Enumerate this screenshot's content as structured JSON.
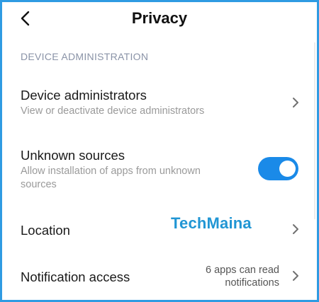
{
  "header": {
    "title": "Privacy",
    "back_icon": "chevron-left-icon"
  },
  "section": {
    "label": "DEVICE ADMINISTRATION"
  },
  "items": [
    {
      "title": "Device administrators",
      "subtitle": "View or deactivate device administrators",
      "icon": "chevron-right-icon"
    },
    {
      "title": "Unknown sources",
      "subtitle": "Allow installation of apps from unknown sources",
      "toggle_on": true,
      "toggle_color": "#1a8ae8"
    },
    {
      "title": "Location",
      "icon": "chevron-right-icon"
    },
    {
      "title": "Notification access",
      "value": "6 apps can read notifications",
      "icon": "chevron-right-icon"
    }
  ],
  "watermark": {
    "text": "TechMaina",
    "color": "#2196d4"
  },
  "colors": {
    "accent": "#1a8ae8",
    "frame_border": "#2f9be2",
    "section_header": "#8a93a7"
  }
}
